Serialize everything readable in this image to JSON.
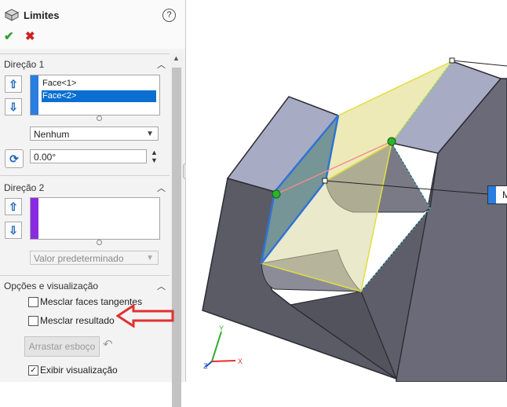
{
  "header": {
    "title": "Limites",
    "help": "?"
  },
  "actions": {
    "ok": "✔",
    "cancel": "✖"
  },
  "direction1": {
    "title": "Direção 1",
    "faces": [
      "Face<1>",
      "Face<2>"
    ],
    "selected_index": 1,
    "end_condition": "Nenhum",
    "angle": "0.00°"
  },
  "direction2": {
    "title": "Direção 2",
    "end_condition": "Valor predeterminado"
  },
  "options": {
    "title": "Opções e visualização",
    "merge_tangent": {
      "label": "Mesclar faces tangentes",
      "checked": false
    },
    "merge_result": {
      "label": "Mesclar resultado",
      "checked": false
    },
    "drag_sketch": "Arrastar esboço",
    "show_preview": {
      "label": "Exibir visualização",
      "checked": true
    }
  },
  "viewport": {
    "callout_text": "M",
    "axes": {
      "x": "X",
      "y": "Y",
      "z": "Z"
    }
  },
  "colors": {
    "accent": "#1a63b7",
    "selection": "#0a6fd1",
    "dir2": "#8a2be2",
    "arrow": "#e23030",
    "body": "#5a5a64",
    "top": "#a8abc4"
  }
}
